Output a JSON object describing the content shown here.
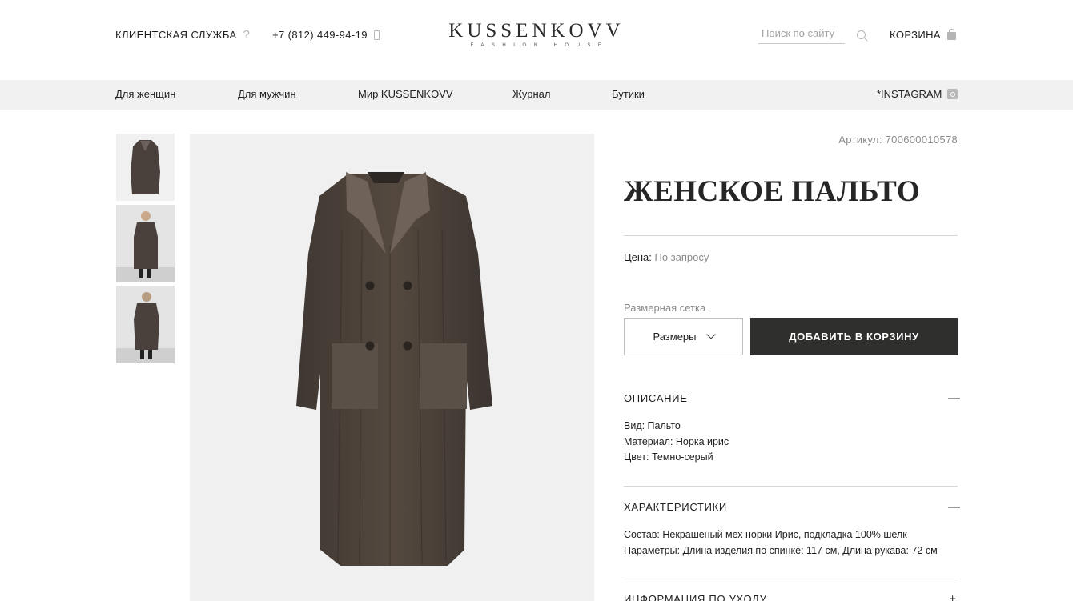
{
  "header": {
    "support_label": "КЛИЕНТСКАЯ СЛУЖБА",
    "phone": "+7 (812) 449-94-19",
    "logo_main": "KUSSENKOVV",
    "logo_sub": "FASHION HOUSE",
    "search_placeholder": "Поиск по сайту",
    "cart_label": "КОРЗИНА"
  },
  "nav": {
    "items": [
      "Для женщин",
      "Для мужчин",
      "Мир KUSSENKOVV",
      "Журнал",
      "Бутики"
    ],
    "instagram": "*INSTAGRAM"
  },
  "product": {
    "sku": "Артикул: 700600010578",
    "title": "ЖЕНСКОЕ ПАЛЬТО",
    "price_label": "Цена:",
    "price_value": "По запросу",
    "size_grid_label": "Размерная сетка",
    "size_select": "Размеры",
    "add_to_cart": "ДОБАВИТЬ В КОРЗИНУ",
    "sections": [
      {
        "title": "ОПИСАНИЕ",
        "toggle": "—",
        "lines": [
          "Вид: Пальто",
          "Материал: Норка ирис",
          "Цвет: Темно-серый"
        ]
      },
      {
        "title": "ХАРАКТЕРИСТИКИ",
        "toggle": "—",
        "lines": [
          "Состав: Некрашеный мех норки Ирис, подкладка 100% шелк",
          "Параметры: Длина изделия по спинке: 117 см, Длина рукава: 72 см"
        ]
      },
      {
        "title": "ИНФОРМАЦИЯ ПО УХОДУ",
        "toggle": "+"
      }
    ]
  },
  "colors": {
    "nav_bg": "#f1f1f1",
    "button_bg": "#2f2f2d",
    "coat": "#4a413c"
  }
}
